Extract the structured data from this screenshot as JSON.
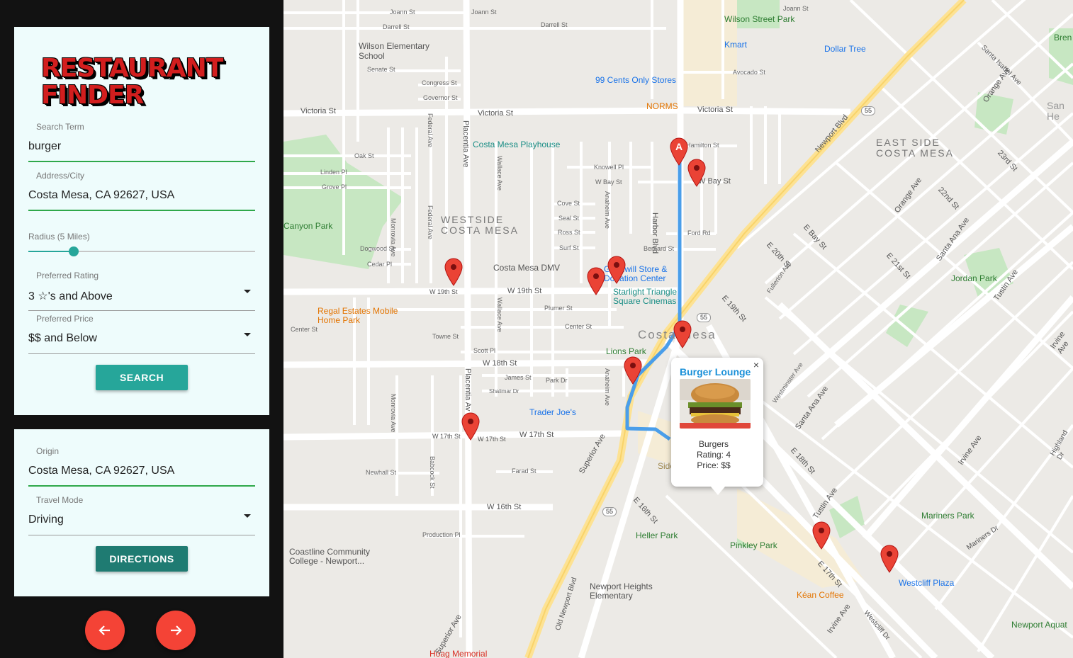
{
  "app": {
    "logo_line1": "RESTAURANT",
    "logo_line2": "FINDER"
  },
  "search": {
    "term_label": "Search Term",
    "term_value": "burger",
    "address_label": "Address/City",
    "address_value": "Costa Mesa, CA 92627, USA",
    "radius_label": "Radius (5 Miles)",
    "radius_fraction": 0.2,
    "rating_label": "Preferred Rating",
    "rating_value": "3 ☆'s and Above",
    "price_label": "Preferred Price",
    "price_value": "$$ and Below",
    "search_button": "SEARCH"
  },
  "directions": {
    "origin_label": "Origin",
    "origin_value": "Costa Mesa, CA 92627, USA",
    "mode_label": "Travel Mode",
    "mode_value": "Driving",
    "directions_button": "DIRECTIONS"
  },
  "nav": {
    "prev_icon": "arrow-left-icon",
    "next_icon": "arrow-right-icon"
  },
  "colors": {
    "accent": "#26a69a",
    "accent_dark": "#1f7b72",
    "underline": "#2fa84a",
    "fab": "#f44336",
    "marker": "#ea4335",
    "route": "#4a9eea"
  },
  "map": {
    "marker_origin_label": "A",
    "info": {
      "name": "Burger Lounge",
      "category": "Burgers",
      "rating": "Rating: 4",
      "price": "Price: $$",
      "close": "×"
    },
    "places": {
      "wilson_park": "Wilson Street Park",
      "kmart": "Kmart",
      "dollar_tree": "Dollar Tree",
      "wilson_school": "Wilson Elementary School",
      "ninety_nine": "99 Cents Only Stores",
      "norms": "NORMS",
      "playhouse": "Costa Mesa Playhouse",
      "westside": "WESTSIDE COSTA MESA",
      "eastside": "EAST SIDE COSTA MESA",
      "dmv": "Costa Mesa DMV",
      "goodwill": "Goodwill Store & Donation Center",
      "starlight": "Starlight Triangle Square Cinemas",
      "regal": "Regal Estates Mobile Home Park",
      "costa_mesa": "Costa Mesa",
      "lions": "Lions Park",
      "traderjoes": "Trader Joe's",
      "canyon": "Canyon Park",
      "jordan": "Jordan Park",
      "heller": "Heller Park",
      "pinkley": "Pinkley Park",
      "coastline": "Coastline Community College - Newport...",
      "newport_heights": "Newport Heights Elementary",
      "mariners": "Mariners Park",
      "westcliff": "Westcliff Plaza",
      "kean": "Kéan Coffee",
      "hoag": "Hoag Memorial",
      "newport_aqua": "Newport Aquat",
      "brent": "Bren",
      "san_he": "San He",
      "side": "Side"
    },
    "streets": {
      "victoria_w": "Victoria St",
      "victoria_e": "Victoria St",
      "w19": "W 19th St",
      "w19b": "W 19th St",
      "w18": "W 18th St",
      "w17": "W 17th St",
      "w17b": "W 17th St",
      "w16": "W 16th St",
      "harbor": "Harbor Blvd",
      "placentia": "Placentia Ave",
      "placentia2": "Placentia Av",
      "newport": "Newport Blvd",
      "joann": "Joann St",
      "darrell": "Darrell St",
      "senate": "Senate St",
      "congress": "Congress St",
      "governor": "Governor St",
      "oak": "Oak St",
      "linden": "Linden Pl",
      "grove": "Grove Pl",
      "dogwood": "Dogwood St",
      "cedar": "Cedar Pl",
      "center": "Center St",
      "towne": "Towne St",
      "scott": "Scott Pl",
      "james": "James St",
      "shalimar": "Shalimar Dr",
      "plumer": "Plumer St",
      "park_dr": "Park Dr",
      "newhall": "Newhall St",
      "farad": "Farad St",
      "production": "Production Pl",
      "cove": "Cove St",
      "seal": "Seal St",
      "ross": "Ross St",
      "surf": "Surf St",
      "knowell": "Knowell Pl",
      "wbay": "W Bay St",
      "bernard": "Bernard St",
      "ford": "Ford Rd",
      "hamilton": "Hamilton St",
      "wbay2": "W Bay St",
      "avocado": "Avocado St",
      "e19": "E 19th St",
      "e20": "E 20th St",
      "ebay": "E Bay St",
      "e21": "E 21st St",
      "e22": "22nd St",
      "e23": "23rd St",
      "e18": "E 18th St",
      "e17": "E 17th St",
      "e16": "E 16th St",
      "superior": "Superior Ave",
      "santa_ana": "Santa Ana Ave",
      "tustin": "Tustin Ave",
      "irvine": "Irvine Ave",
      "orange": "Orange Ave",
      "fullerton": "Fullerton Ave",
      "westminster": "Westminster Ave",
      "monrovia": "Monrovia Ave",
      "federal": "Federal Ave",
      "wallace": "Wallace Ave",
      "anaheim": "Anaheim Ave",
      "babcock": "Babcock St",
      "westcliff_dr": "Westcliff Dr",
      "old_newport": "Old Newport Blvd",
      "e17b": "E 17th St",
      "mariners_dr": "Mariners Dr",
      "highland": "Highland Dr",
      "santa_isabel": "Santa Isabel Ave",
      "hwy55": "55"
    }
  }
}
